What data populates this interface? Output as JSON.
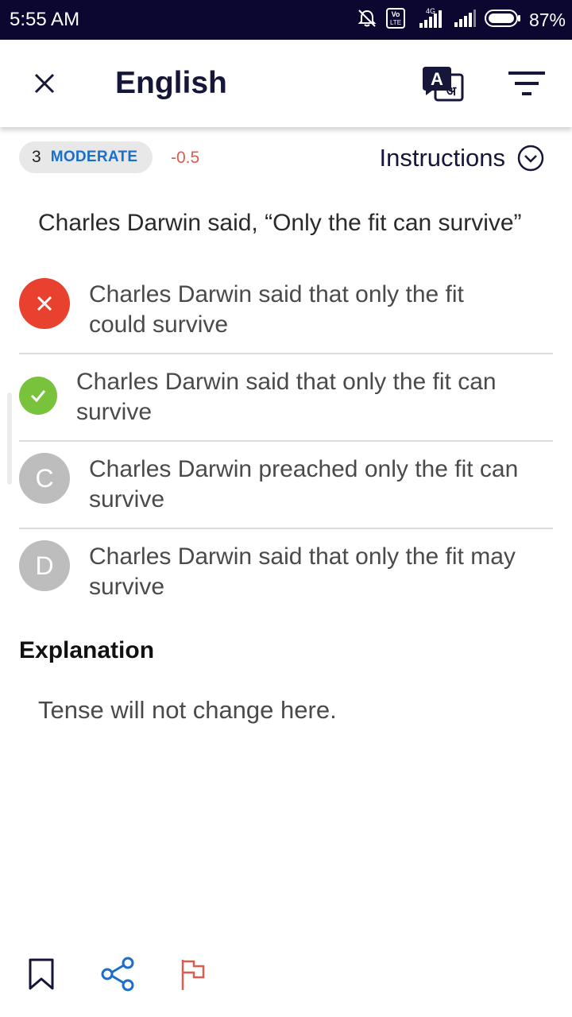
{
  "status_bar": {
    "time": "5:55 AM",
    "battery_percent": "87%",
    "icons": [
      "alarm-off-icon",
      "volte-icon",
      "signal-4g-icon",
      "signal-icon",
      "battery-icon"
    ],
    "volte_label_top": "Vo",
    "volte_label_bottom": "LTE",
    "network_label": "4G",
    "background_color": "#0c0731"
  },
  "header": {
    "title": "English",
    "close_icon": "close-icon",
    "translate_icon": "translate-icon",
    "translate_glyph_a": "A",
    "translate_glyph_b": "अ",
    "filter_icon": "filter-icon"
  },
  "meta": {
    "difficulty_level": "3",
    "difficulty_label": "MODERATE",
    "negative_marks": "-0.5",
    "instructions_label": "Instructions",
    "accent_color": "#1a6fc9",
    "negative_color": "#e15a4e"
  },
  "question": {
    "text": "Charles Darwin said, “Only the fit can survive”"
  },
  "options": [
    {
      "marker": "×",
      "state": "wrong",
      "text_line1": "Charles Darwin said that only the fit",
      "text_line2": "could survive",
      "color": "#e8412f"
    },
    {
      "marker": "✓",
      "state": "correct",
      "text_line1": "Charles Darwin said that only the fit can",
      "text_line2": "survive",
      "color": "#78c23c"
    },
    {
      "marker": "C",
      "state": "neutral",
      "text_line1": "Charles Darwin preached only the fit can",
      "text_line2": "survive",
      "color": "#bdbdbd"
    },
    {
      "marker": "D",
      "state": "neutral",
      "text_line1": "Charles Darwin said that only the fit may",
      "text_line2": "survive",
      "color": "#bdbdbd"
    }
  ],
  "explanation": {
    "heading": "Explanation",
    "text": "Tense will not change here."
  },
  "bottom_actions": {
    "bookmark_icon": "bookmark-icon",
    "share_icon": "share-icon",
    "report_icon": "flag-icon",
    "share_color": "#1a6fc9",
    "report_color": "#e15a4e"
  }
}
